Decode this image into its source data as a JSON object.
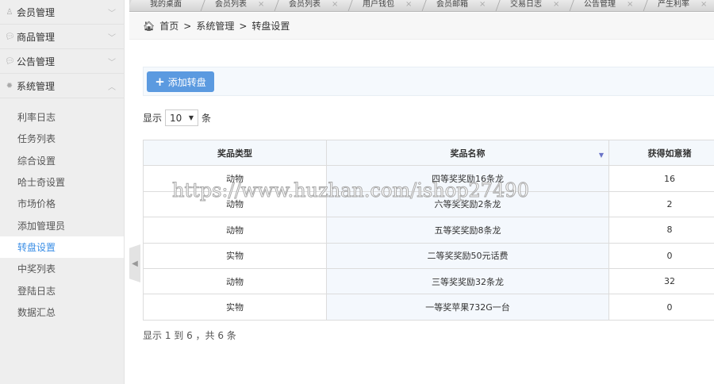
{
  "sidebar": {
    "menus": [
      {
        "label": "会员管理",
        "icon": "user-icon",
        "chev": "﹀"
      },
      {
        "label": "商品管理",
        "icon": "chat-icon",
        "chev": "﹀"
      },
      {
        "label": "公告管理",
        "icon": "chat-icon",
        "chev": "﹀"
      },
      {
        "label": "系统管理",
        "icon": "gear-icon",
        "chev": "︿"
      }
    ],
    "items": [
      "利率日志",
      "任务列表",
      "综合设置",
      "哈士奇设置",
      "市场价格",
      "添加管理员",
      "转盘设置",
      "中奖列表",
      "登陆日志",
      "数据汇总"
    ],
    "active": "转盘设置"
  },
  "tabs": [
    "我的桌面",
    "会员列表",
    "会员列表",
    "用户钱包",
    "会员邮箱",
    "交易日志",
    "公告管理",
    "产生利率"
  ],
  "breadcrumb": {
    "home": "首页",
    "sep": ">",
    "section": "系统管理",
    "current": "转盘设置"
  },
  "toolbar": {
    "add_label": "添加转盘"
  },
  "length": {
    "prefix": "显示",
    "value": "10",
    "suffix": "条"
  },
  "table": {
    "headers": [
      "奖品类型",
      "奖品名称",
      "获得如意猪"
    ],
    "rows": [
      [
        "动物",
        "四等奖奖励16条龙",
        "16"
      ],
      [
        "动物",
        "六等奖奖励2条龙",
        "2"
      ],
      [
        "动物",
        "五等奖奖励8条龙",
        "8"
      ],
      [
        "实物",
        "二等奖奖励50元话费",
        "0"
      ],
      [
        "动物",
        "三等奖奖励32条龙",
        "32"
      ],
      [
        "实物",
        "一等奖苹果732G一台",
        "0"
      ]
    ]
  },
  "info": "显示 1 到 6 ，共 6 条",
  "watermark": "https://www.huzhan.com/ishop27490"
}
